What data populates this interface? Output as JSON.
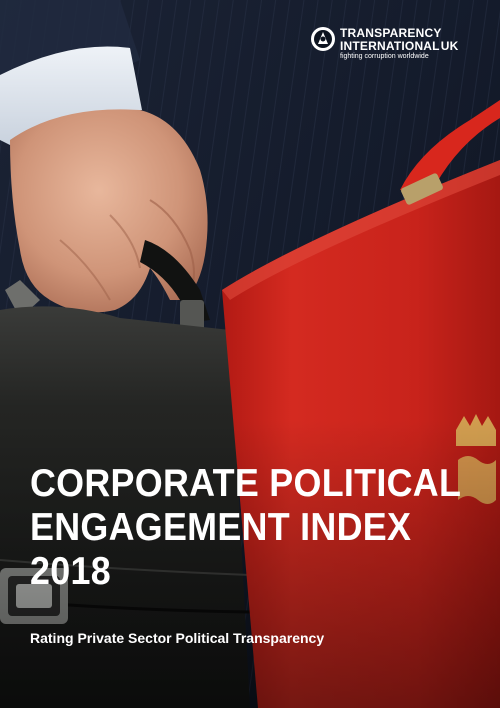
{
  "header": {
    "org_line1": "TRANSPARENCY",
    "org_line2": "INTERNATIONAL",
    "org_line2_suffix": "UK",
    "tagline": "fighting corruption worldwide"
  },
  "cover": {
    "title_lines": [
      "CORPORATE POLITICAL",
      "ENGAGEMENT INDEX",
      "2018"
    ],
    "subtitle": "Rating Private Sector Political Transparency"
  },
  "colors": {
    "red_box": "#c8231b",
    "leather": "#1c1d1c",
    "suit": "#161d2d",
    "text": "#ffffff"
  },
  "icons": {
    "logo": "transparency-international-logo-icon"
  }
}
